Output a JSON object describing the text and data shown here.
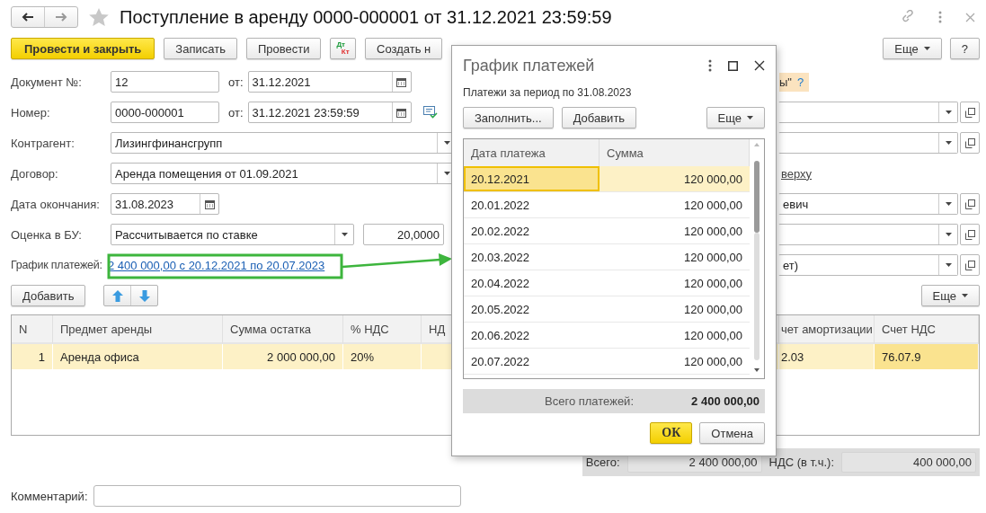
{
  "title": "Поступление в аренду 0000-000001 от 31.12.2021 23:59:59",
  "favorite": false,
  "toolbar": {
    "left": [
      {
        "kind": "primary",
        "label": "Провести и закрыть"
      },
      {
        "kind": "plain",
        "label": "Записать"
      },
      {
        "kind": "plain",
        "label": "Провести"
      },
      {
        "kind": "dtkt",
        "parts": [
          "Дт",
          "Кт"
        ]
      },
      {
        "kind": "plain",
        "label": "Создать н"
      }
    ],
    "right": [
      {
        "kind": "menu",
        "label": "Еще"
      },
      {
        "kind": "plain",
        "label": "?"
      }
    ]
  },
  "fields": [
    {
      "kind": "number_date",
      "label": "Документ №:",
      "value": "12",
      "date_label": "от:",
      "date": "31.12.2021"
    },
    {
      "kind": "number_datetime",
      "label": "Номер:",
      "value": "0000-000001",
      "date_label": "от:",
      "date": "31.12.2021 23:59:59"
    },
    {
      "kind": "select",
      "label": "Контрагент:",
      "value": "Лизингфинансгрупп"
    },
    {
      "kind": "select",
      "label": "Договор:",
      "value": "Аренда помещения от 01.09.2021"
    },
    {
      "kind": "date",
      "label": "Дата окончания:",
      "value": "31.08.2023"
    },
    {
      "kind": "select_rate",
      "label": "Оценка в БУ:",
      "value": "Рассчитывается по ставке",
      "rate": "20,0000"
    },
    {
      "kind": "link",
      "label": "График платежей:",
      "value": "2 400 000,00 с 20.12.2021 по 20.07.2023"
    }
  ],
  "right_fields": [
    {
      "kind": "hint",
      "value": "ы\"",
      "help": "?"
    },
    {
      "kind": "select"
    },
    {
      "kind": "select"
    },
    {
      "kind": "link",
      "value": "верху"
    },
    {
      "kind": "select",
      "value": "евич"
    },
    {
      "kind": "select"
    },
    {
      "kind": "select",
      "value": "ет)"
    }
  ],
  "items": {
    "add": "Добавить",
    "more": "Еще",
    "columns": [
      {
        "label": "N",
        "kind": "number"
      },
      {
        "label": "Предмет аренды"
      },
      {
        "label": "Сумма остатка",
        "kind": "number"
      },
      {
        "label": "% НДС"
      },
      {
        "label": "НД"
      },
      {
        "label": "чет амортизации"
      },
      {
        "label": "Счет НДС"
      }
    ],
    "rows": [
      {
        "selected": true,
        "cells": [
          {
            "text": "1"
          },
          {
            "text": "Аренда офиса"
          },
          {
            "text": "2 000 000,00"
          },
          {
            "text": "20%"
          },
          {},
          {
            "text": "2.03"
          },
          {
            "text": "76.07.9",
            "current": true
          }
        ]
      }
    ]
  },
  "totals": {
    "total_label": "Всего:",
    "total": "2 400 000,00",
    "vat_label": "НДС (в т.ч.):",
    "vat": "400 000,00"
  },
  "comment": {
    "label": "Комментарий:"
  },
  "dialog": {
    "title": "График платежей",
    "subtitle": "Платежи за период по 31.08.2023",
    "buttons": [
      {
        "kind": "plain",
        "label": "Заполнить..."
      },
      {
        "kind": "plain",
        "label": "Добавить"
      }
    ],
    "more": "Еще",
    "columns": [
      "Дата платежа",
      "Сумма"
    ],
    "rows": [
      {
        "date": "20.12.2021",
        "amount": "120 000,00",
        "selected": true
      },
      {
        "date": "20.01.2022",
        "amount": "120 000,00",
        "selected": false
      },
      {
        "date": "20.02.2022",
        "amount": "120 000,00",
        "selected": false
      },
      {
        "date": "20.03.2022",
        "amount": "120 000,00",
        "selected": false
      },
      {
        "date": "20.04.2022",
        "amount": "120 000,00",
        "selected": false
      },
      {
        "date": "20.05.2022",
        "amount": "120 000,00",
        "selected": false
      },
      {
        "date": "20.06.2022",
        "amount": "120 000,00",
        "selected": false
      },
      {
        "date": "20.07.2022",
        "amount": "120 000,00",
        "selected": false
      }
    ],
    "total_label": "Всего платежей:",
    "total": "2 400 000,00",
    "ok": "ОК",
    "cancel": "Отмена"
  }
}
